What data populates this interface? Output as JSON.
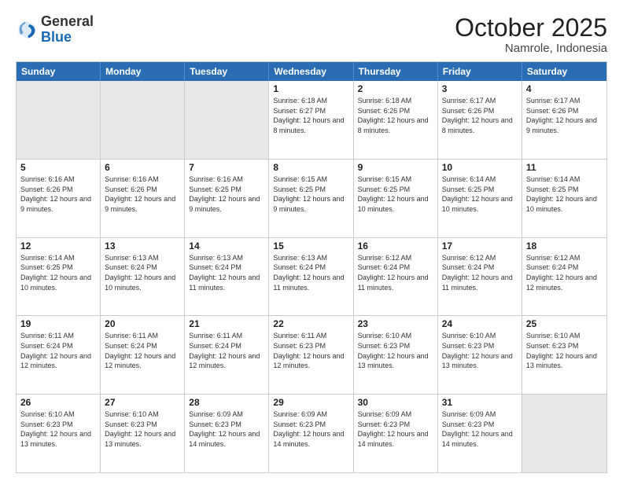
{
  "header": {
    "logo": {
      "line1": "General",
      "line2": "Blue"
    },
    "month": "October 2025",
    "location": "Namrole, Indonesia"
  },
  "weekdays": [
    "Sunday",
    "Monday",
    "Tuesday",
    "Wednesday",
    "Thursday",
    "Friday",
    "Saturday"
  ],
  "rows": [
    [
      {
        "day": "",
        "info": "",
        "shaded": true
      },
      {
        "day": "",
        "info": "",
        "shaded": true
      },
      {
        "day": "",
        "info": "",
        "shaded": true
      },
      {
        "day": "1",
        "info": "Sunrise: 6:18 AM\nSunset: 6:27 PM\nDaylight: 12 hours and 8 minutes."
      },
      {
        "day": "2",
        "info": "Sunrise: 6:18 AM\nSunset: 6:26 PM\nDaylight: 12 hours and 8 minutes."
      },
      {
        "day": "3",
        "info": "Sunrise: 6:17 AM\nSunset: 6:26 PM\nDaylight: 12 hours and 8 minutes."
      },
      {
        "day": "4",
        "info": "Sunrise: 6:17 AM\nSunset: 6:26 PM\nDaylight: 12 hours and 9 minutes."
      }
    ],
    [
      {
        "day": "5",
        "info": "Sunrise: 6:16 AM\nSunset: 6:26 PM\nDaylight: 12 hours and 9 minutes."
      },
      {
        "day": "6",
        "info": "Sunrise: 6:16 AM\nSunset: 6:26 PM\nDaylight: 12 hours and 9 minutes."
      },
      {
        "day": "7",
        "info": "Sunrise: 6:16 AM\nSunset: 6:25 PM\nDaylight: 12 hours and 9 minutes."
      },
      {
        "day": "8",
        "info": "Sunrise: 6:15 AM\nSunset: 6:25 PM\nDaylight: 12 hours and 9 minutes."
      },
      {
        "day": "9",
        "info": "Sunrise: 6:15 AM\nSunset: 6:25 PM\nDaylight: 12 hours and 10 minutes."
      },
      {
        "day": "10",
        "info": "Sunrise: 6:14 AM\nSunset: 6:25 PM\nDaylight: 12 hours and 10 minutes."
      },
      {
        "day": "11",
        "info": "Sunrise: 6:14 AM\nSunset: 6:25 PM\nDaylight: 12 hours and 10 minutes."
      }
    ],
    [
      {
        "day": "12",
        "info": "Sunrise: 6:14 AM\nSunset: 6:25 PM\nDaylight: 12 hours and 10 minutes."
      },
      {
        "day": "13",
        "info": "Sunrise: 6:13 AM\nSunset: 6:24 PM\nDaylight: 12 hours and 10 minutes."
      },
      {
        "day": "14",
        "info": "Sunrise: 6:13 AM\nSunset: 6:24 PM\nDaylight: 12 hours and 11 minutes."
      },
      {
        "day": "15",
        "info": "Sunrise: 6:13 AM\nSunset: 6:24 PM\nDaylight: 12 hours and 11 minutes."
      },
      {
        "day": "16",
        "info": "Sunrise: 6:12 AM\nSunset: 6:24 PM\nDaylight: 12 hours and 11 minutes."
      },
      {
        "day": "17",
        "info": "Sunrise: 6:12 AM\nSunset: 6:24 PM\nDaylight: 12 hours and 11 minutes."
      },
      {
        "day": "18",
        "info": "Sunrise: 6:12 AM\nSunset: 6:24 PM\nDaylight: 12 hours and 12 minutes."
      }
    ],
    [
      {
        "day": "19",
        "info": "Sunrise: 6:11 AM\nSunset: 6:24 PM\nDaylight: 12 hours and 12 minutes."
      },
      {
        "day": "20",
        "info": "Sunrise: 6:11 AM\nSunset: 6:24 PM\nDaylight: 12 hours and 12 minutes."
      },
      {
        "day": "21",
        "info": "Sunrise: 6:11 AM\nSunset: 6:24 PM\nDaylight: 12 hours and 12 minutes."
      },
      {
        "day": "22",
        "info": "Sunrise: 6:11 AM\nSunset: 6:23 PM\nDaylight: 12 hours and 12 minutes."
      },
      {
        "day": "23",
        "info": "Sunrise: 6:10 AM\nSunset: 6:23 PM\nDaylight: 12 hours and 13 minutes."
      },
      {
        "day": "24",
        "info": "Sunrise: 6:10 AM\nSunset: 6:23 PM\nDaylight: 12 hours and 13 minutes."
      },
      {
        "day": "25",
        "info": "Sunrise: 6:10 AM\nSunset: 6:23 PM\nDaylight: 12 hours and 13 minutes."
      }
    ],
    [
      {
        "day": "26",
        "info": "Sunrise: 6:10 AM\nSunset: 6:23 PM\nDaylight: 12 hours and 13 minutes."
      },
      {
        "day": "27",
        "info": "Sunrise: 6:10 AM\nSunset: 6:23 PM\nDaylight: 12 hours and 13 minutes."
      },
      {
        "day": "28",
        "info": "Sunrise: 6:09 AM\nSunset: 6:23 PM\nDaylight: 12 hours and 14 minutes."
      },
      {
        "day": "29",
        "info": "Sunrise: 6:09 AM\nSunset: 6:23 PM\nDaylight: 12 hours and 14 minutes."
      },
      {
        "day": "30",
        "info": "Sunrise: 6:09 AM\nSunset: 6:23 PM\nDaylight: 12 hours and 14 minutes."
      },
      {
        "day": "31",
        "info": "Sunrise: 6:09 AM\nSunset: 6:23 PM\nDaylight: 12 hours and 14 minutes."
      },
      {
        "day": "",
        "info": "",
        "shaded": true
      }
    ]
  ]
}
